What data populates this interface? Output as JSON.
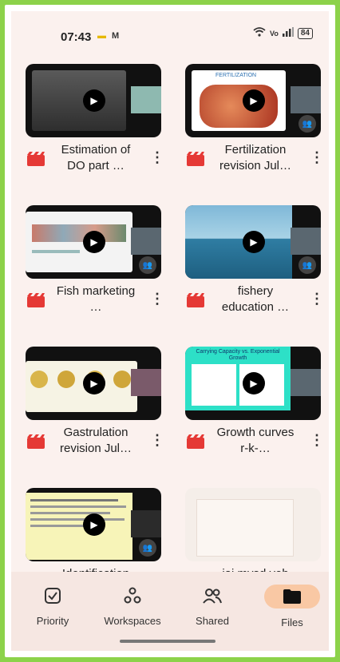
{
  "status_bar": {
    "time": "07:43",
    "battery": "84"
  },
  "files": [
    {
      "title": "Estimation of DO part …",
      "thumb": "#3b3b3b",
      "shared": false
    },
    {
      "title": "Fertilization revision Jul…",
      "thumb": "#c24b35",
      "slide_title": "FERTILIZATION",
      "shared": true
    },
    {
      "title": "Fish marketing …",
      "thumb": "#e6e6e6",
      "shared": true
    },
    {
      "title": "fishery education …",
      "thumb": "#4f8fb0",
      "shared": true
    },
    {
      "title": "Gastrulation revision Jul…",
      "thumb": "#e9e3cc",
      "shared": false
    },
    {
      "title": "Growth curves r-k-…",
      "thumb": "#2de0c7",
      "slide_title": "Carrying Capacity vs. Exponential Growth",
      "shared": false
    },
    {
      "title": "Identification",
      "thumb": "#f5f2b0",
      "shared": true
    },
    {
      "title": "jai mysd veb",
      "thumb": "#f5eee9",
      "shared": false
    }
  ],
  "nav": {
    "items": [
      {
        "label": "Priority",
        "icon": "priority-icon"
      },
      {
        "label": "Workspaces",
        "icon": "workspaces-icon"
      },
      {
        "label": "Shared",
        "icon": "shared-icon"
      },
      {
        "label": "Files",
        "icon": "folder-icon",
        "active": true
      }
    ]
  },
  "colors": {
    "accent": "#f9c8a4",
    "file_icon": "#e53935",
    "background": "#fbf1ee"
  }
}
